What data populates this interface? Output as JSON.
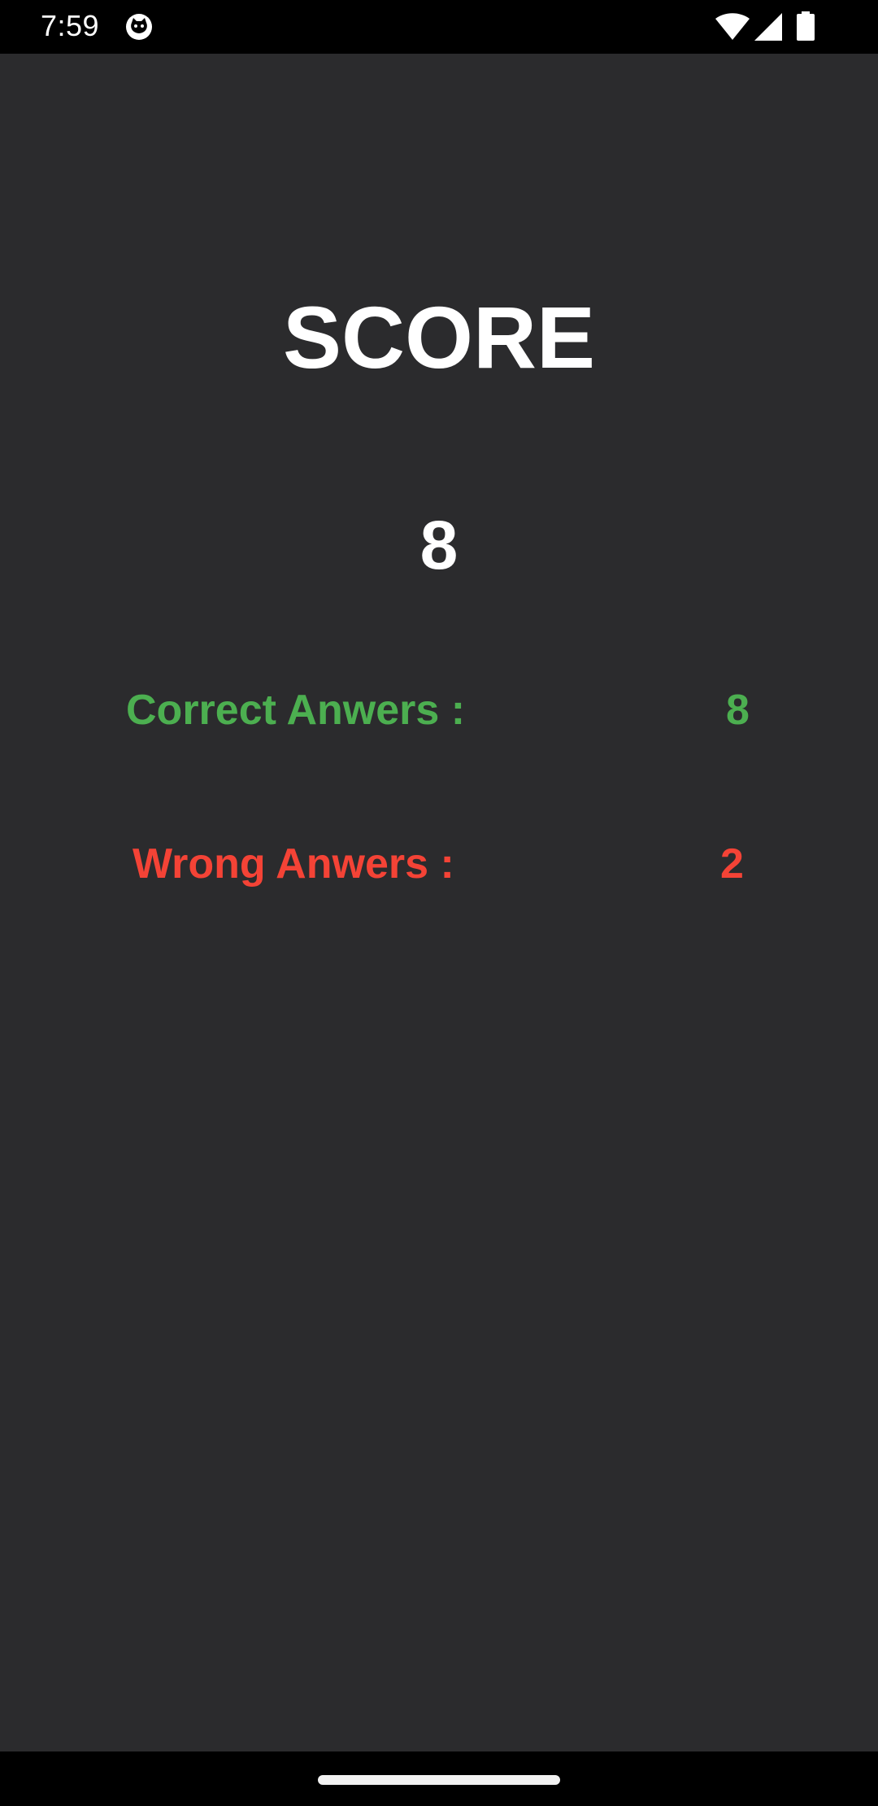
{
  "status_bar": {
    "time": "7:59",
    "icons": [
      "cat-notification-icon",
      "wifi-icon",
      "signal-icon",
      "battery-icon"
    ]
  },
  "screen": {
    "title": "SCORE",
    "score": "8",
    "correct": {
      "label": "Correct Anwers :",
      "value": "8",
      "color": "#4caf50"
    },
    "wrong": {
      "label": "Wrong Anwers :",
      "value": "2",
      "color": "#f44336"
    }
  },
  "colors": {
    "background": "#2b2b2d",
    "text": "#ffffff"
  }
}
